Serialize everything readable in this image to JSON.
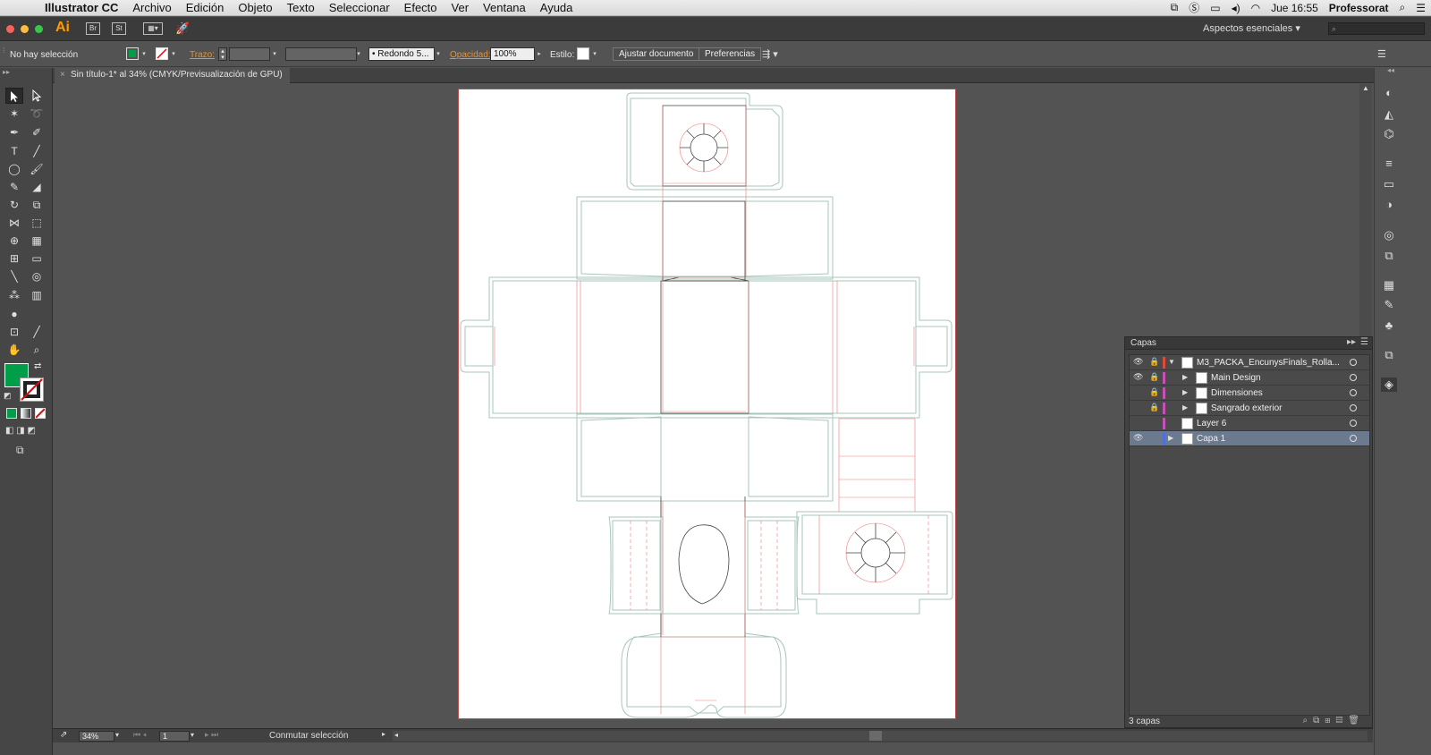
{
  "menubar": {
    "app_name": "Illustrator CC",
    "items": [
      "Archivo",
      "Edición",
      "Objeto",
      "Texto",
      "Seleccionar",
      "Efecto",
      "Ver",
      "Ventana",
      "Ayuda"
    ],
    "clock": "Jue 16:55",
    "user": "Professorat"
  },
  "appbar": {
    "logo": "Ai",
    "bridge": "Br",
    "stock": "St",
    "workspace": "Aspectos esenciales"
  },
  "control": {
    "selection": "No hay selección",
    "stroke_label": "Trazo:",
    "brush": "Redondo 5...",
    "opacity_label": "Opacidad:",
    "opacity_value": "100%",
    "style_label": "Estilo:",
    "fit_button": "Ajustar documento",
    "prefs_button": "Preferencias",
    "fill_color": "#009e48"
  },
  "document": {
    "tab_title": "Sin título-1* al 34% (CMYK/Previsualización de GPU)"
  },
  "layers": {
    "panel_title": "Capas",
    "count": "3 capas",
    "rows": [
      {
        "name": "M3_PACKA_EncunysFinals_Rolla...",
        "color": "#e04a3a",
        "visible": true,
        "locked": true,
        "expanded": true,
        "indent": 0
      },
      {
        "name": "Main Design",
        "color": "#c64fb8",
        "visible": true,
        "locked": true,
        "expanded": false,
        "indent": 1
      },
      {
        "name": "Dimensiones",
        "color": "#c64fb8",
        "visible": false,
        "locked": true,
        "expanded": false,
        "indent": 1
      },
      {
        "name": "Sangrado exterior",
        "color": "#c64fb8",
        "visible": false,
        "locked": true,
        "expanded": false,
        "indent": 1
      },
      {
        "name": "Layer 6",
        "color": "#c64fb8",
        "visible": false,
        "locked": false,
        "expanded": false,
        "indent": 1
      },
      {
        "name": "Capa 1",
        "color": "#4a6fe0",
        "visible": true,
        "locked": false,
        "expanded": false,
        "indent": 0,
        "selected": true
      }
    ]
  },
  "status": {
    "zoom": "34%",
    "page": "1",
    "message": "Conmutar selección"
  }
}
